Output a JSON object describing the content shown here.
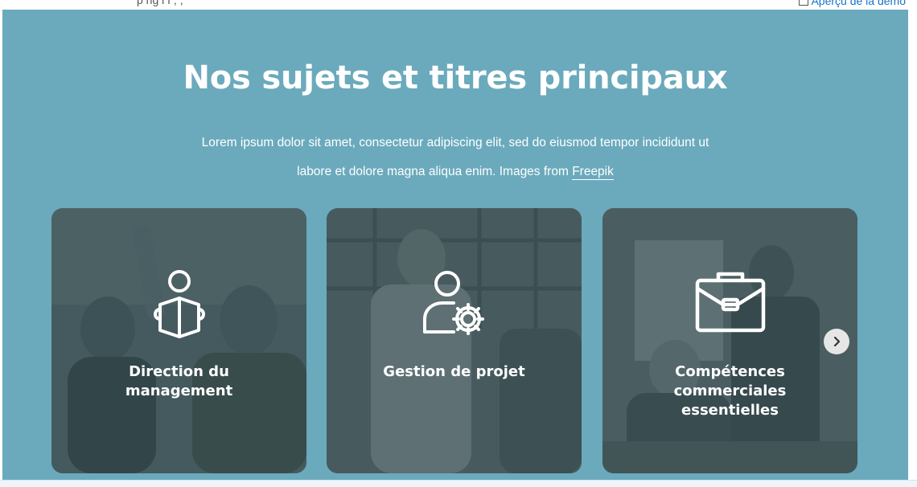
{
  "browser": {
    "top_text": "p ng l f  ,  ,",
    "demo_link": "Aperçu de la démo"
  },
  "section": {
    "title": "Nos sujets et titres principaux",
    "lead_line1": "Lorem ipsum dolor sit amet, consectetur adipiscing elit, sed do eiusmod tempor incididunt ut",
    "lead_line2_prefix": "labore et dolore magna aliqua enim. Images from",
    "lead_link": "Freepik"
  },
  "cards": [
    {
      "title_line1": "Direction du",
      "title_line2": "management",
      "title_line3": "",
      "icon": "person-reading-book-icon"
    },
    {
      "title_line1": "Gestion de projet",
      "title_line2": "",
      "title_line3": "",
      "icon": "person-gear-icon"
    },
    {
      "title_line1": "Compétences",
      "title_line2": "commerciales",
      "title_line3": "essentielles",
      "icon": "briefcase-icon"
    }
  ],
  "carousel": {
    "next_icon": "chevron-right-icon"
  },
  "colors": {
    "section_bg": "#6aaabc",
    "card_overlay": "#3f5054",
    "text": "#ffffff",
    "link": "#1a73c8"
  }
}
